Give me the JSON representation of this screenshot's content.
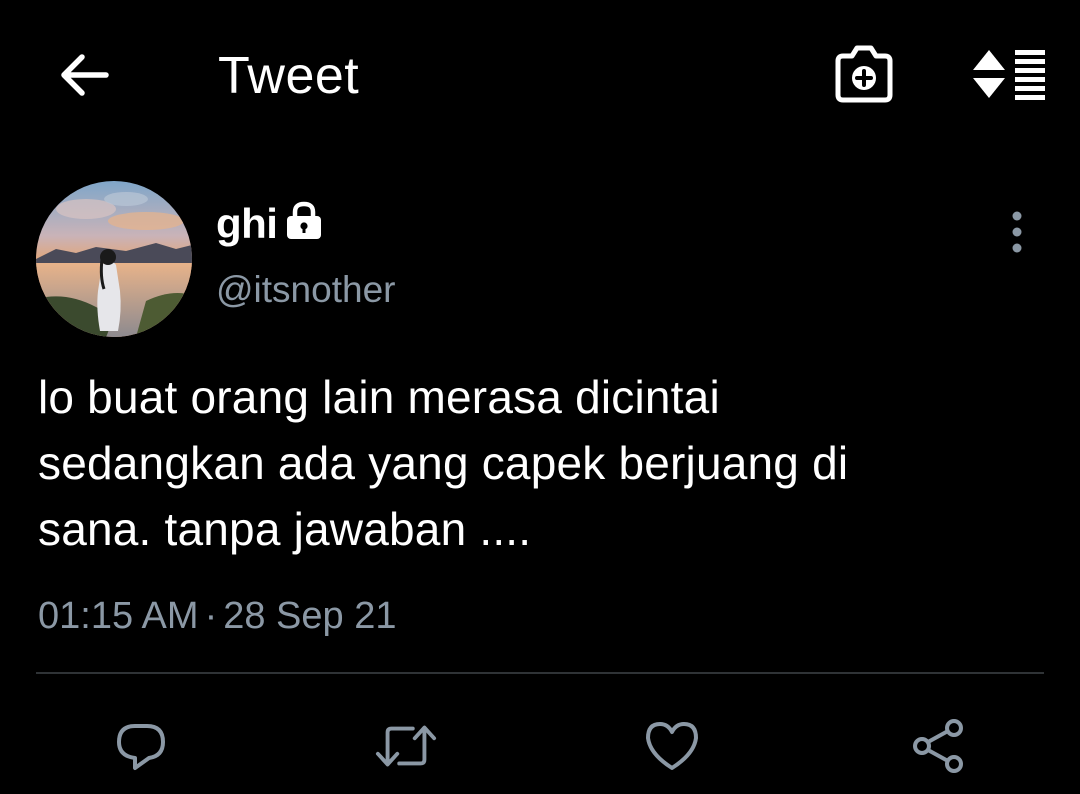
{
  "header": {
    "title": "Tweet",
    "icons": [
      "back-arrow-icon",
      "camera-add-icon",
      "sort-icon"
    ]
  },
  "tweet": {
    "author": {
      "display_name": "ghi",
      "handle": "@itsnother",
      "protected_icon": "lock-icon",
      "avatar": "avatar-photo"
    },
    "text_lines": [
      "lo buat orang lain merasa dicintai",
      "sedangkan ada yang capek berjuang di",
      "sana. tanpa jawaban ...."
    ],
    "time": "01:15 AM",
    "separator": "·",
    "date": "28 Sep 21"
  },
  "actions": [
    "reply-icon",
    "retweet-icon",
    "like-icon",
    "share-icon"
  ],
  "colors": {
    "background": "#000000",
    "text": "#ffffff",
    "secondary_text": "#8b98a5",
    "divider": "#2f3336"
  }
}
